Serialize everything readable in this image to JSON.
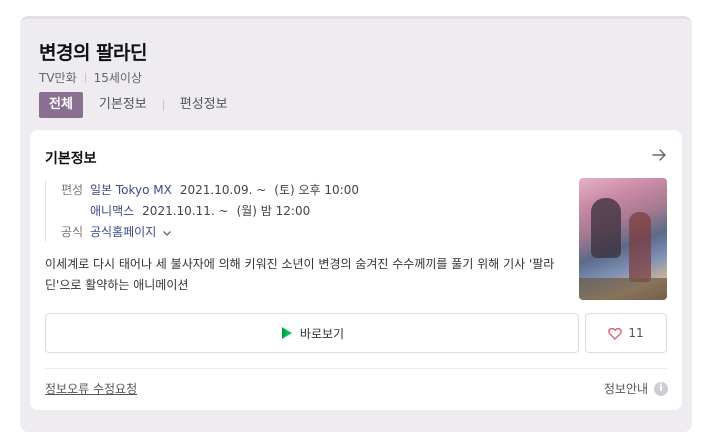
{
  "header": {
    "title": "변경의 팔라딘",
    "category": "TV만화",
    "rating": "15세이상"
  },
  "tabs": [
    "전체",
    "기본정보",
    "편성정보"
  ],
  "card": {
    "title": "기본정보",
    "schedule_label": "편성",
    "schedules": [
      {
        "channel": "일본 Tokyo MX",
        "date": "2021.10.09. ~",
        "time": "(토) 오후 10:00"
      },
      {
        "channel": "애니맥스",
        "date": "2021.10.11. ~",
        "time": "(월) 밤 12:00"
      }
    ],
    "official_label": "공식",
    "official_link": "공식홈페이지",
    "description": "이세계로 다시 태어나 세 불사자에 의해 키워진 소년이 변경의 숨겨진 수수께끼를 풀기 위해 기사 '팔라딘'으로 활약하는 애니메이션",
    "watch_label": "바로보기",
    "like_count": "11",
    "report_label": "정보오류 수정요청",
    "info_guide_label": "정보안내",
    "info_icon_glyph": "i"
  },
  "colors": {
    "accent": "#8a6f92",
    "link": "#3a4a8a",
    "background": "#eeecf1",
    "play_green": "#03c75a"
  },
  "icons": [
    "arrow-right-icon",
    "chevron-down-icon",
    "play-icon",
    "heart-icon",
    "info-icon"
  ]
}
